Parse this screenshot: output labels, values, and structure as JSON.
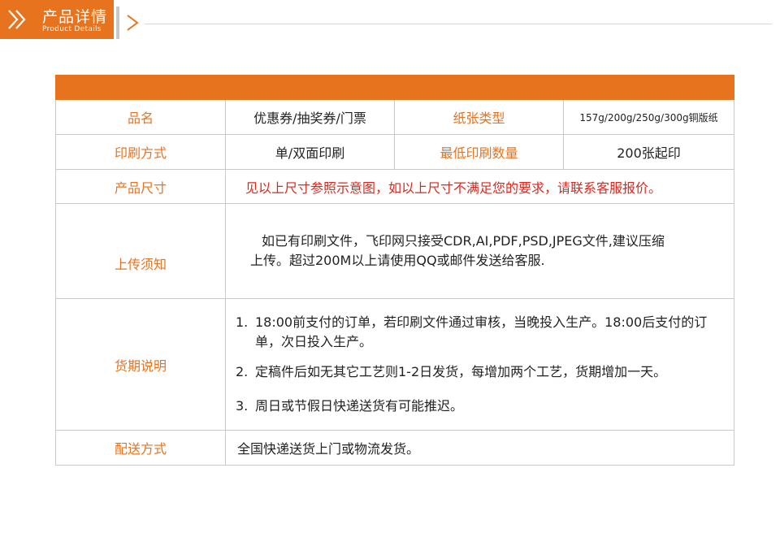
{
  "header": {
    "title": "产品详情",
    "subtitle": "Product Details",
    "accent_color": "#e8731f",
    "icons": [
      "double-chevron-right-icon",
      "chevron-right-icon"
    ]
  },
  "table": {
    "row1": {
      "label1": "品名",
      "value1": "优惠券/抽奖券/门票",
      "label2": "纸张类型",
      "value2": "157g/200g/250g/300g铜版纸"
    },
    "row2": {
      "label1": "印刷方式",
      "value1": "单/双面印刷",
      "label2": "最低印刷数量",
      "value2": "200张起印"
    },
    "row3": {
      "label": "产品尺寸",
      "value": "见以上尺寸参照示意图，如以上尺寸不满足您的要求，请联系客服报价。"
    },
    "row4": {
      "label": "上传须知",
      "line1": "如已有印刷文件，飞印网只接受CDR,AI,PDF,PSD,JPEG文件,建议压缩",
      "line2": "上传。超过200M以上请使用QQ或邮件发送给客服."
    },
    "row5": {
      "label": "货期说明",
      "items": [
        {
          "num": "1.",
          "text": "18:00前支付的订单，若印刷文件通过审核，当晚投入生产。18:00后支付的订单，次日投入生产。"
        },
        {
          "num": "2.",
          "text": "定稿件后如无其它工艺则1-2日发货，每增加两个工艺，货期增加一天。"
        },
        {
          "num": "3.",
          "text": "周日或节假日快递送货有可能推迟。"
        }
      ]
    },
    "row6": {
      "label": "配送方式",
      "value": "全国快递送货上门或物流发货。"
    }
  }
}
